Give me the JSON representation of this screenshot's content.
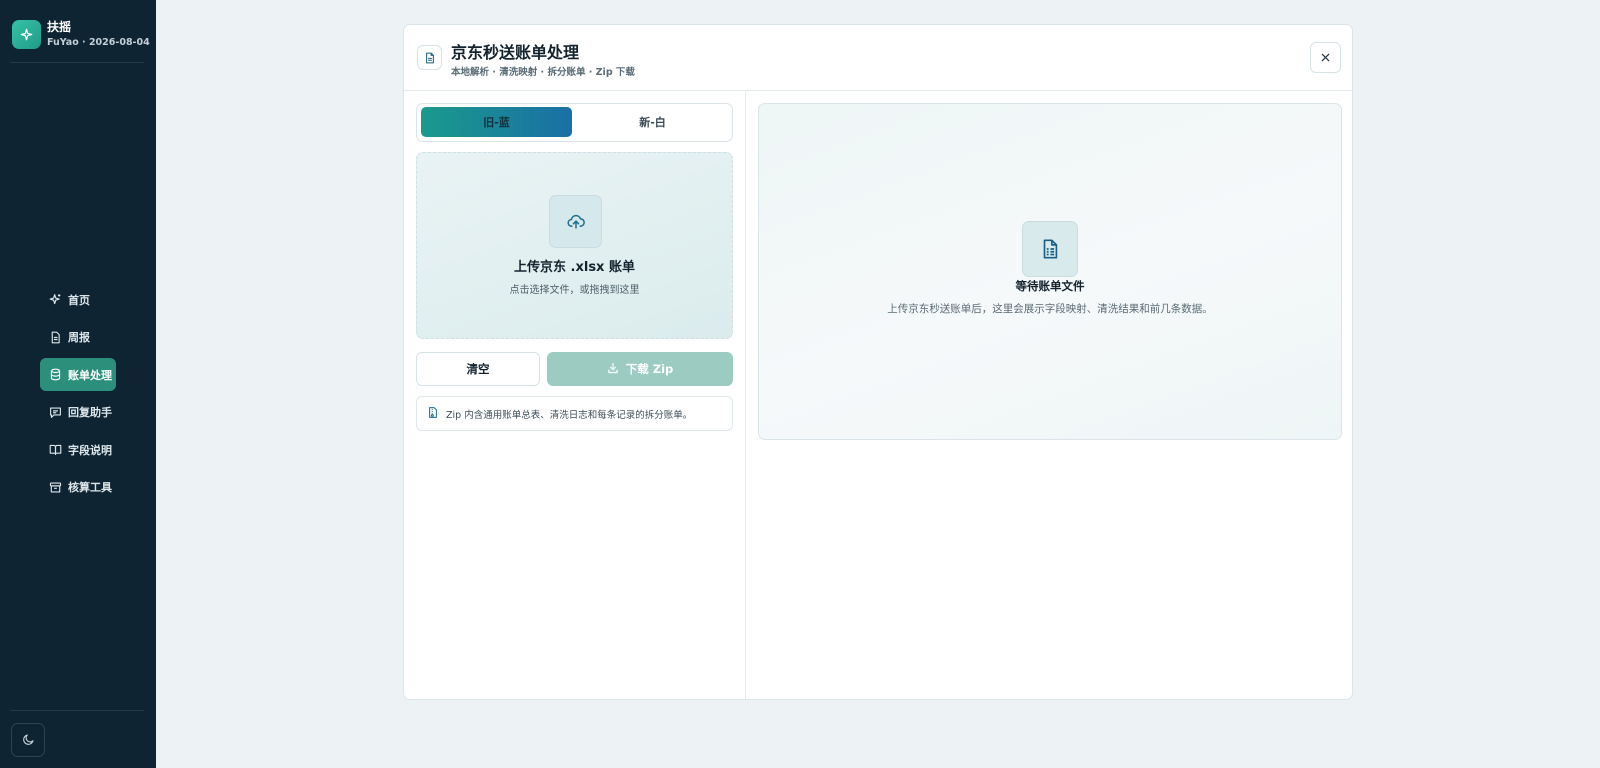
{
  "brand": {
    "name": "扶摇",
    "subtitle": "FuYao · 2026-08-04",
    "icon": "sparkle-icon"
  },
  "sidebar": {
    "items": [
      {
        "label": "首页",
        "icon": "sparkle-icon",
        "active": false
      },
      {
        "label": "周报",
        "icon": "document-icon",
        "active": false
      },
      {
        "label": "账单处理",
        "icon": "database-icon",
        "active": true
      },
      {
        "label": "回复助手",
        "icon": "chat-icon",
        "active": false
      },
      {
        "label": "字段说明",
        "icon": "book-icon",
        "active": false
      },
      {
        "label": "核算工具",
        "icon": "archive-icon",
        "active": false
      }
    ],
    "theme_toggle_icon": "moon-icon"
  },
  "modal": {
    "title": "京东秒送账单处理",
    "subtitle": "本地解析 · 清洗映射 · 拆分账单 · Zip 下载",
    "close_icon": "close-icon",
    "tabs": [
      {
        "label": "旧-蓝",
        "selected": true
      },
      {
        "label": "新-白",
        "selected": false
      }
    ],
    "upload": {
      "title": "上传京东 .xlsx 账单",
      "hint": "点击选择文件，或拖拽到这里",
      "icon": "cloud-upload-icon"
    },
    "clear_label": "清空",
    "download_label": "下载 Zip",
    "download_disabled": true,
    "note": "Zip 内含通用账单总表、清洗日志和每条记录的拆分账单。",
    "preview": {
      "title": "等待账单文件",
      "description": "上传京东秒送账单后，这里会展示字段映射、清洗结果和前几条数据。",
      "icon": "spreadsheet-file-icon"
    }
  },
  "colors": {
    "sidebar_bg": "#0f2433",
    "accent": "#2b8f7b",
    "tab_gradient_start": "#1a9a8c",
    "tab_gradient_end": "#1a6fa5",
    "download_disabled": "#9ccbc2"
  }
}
